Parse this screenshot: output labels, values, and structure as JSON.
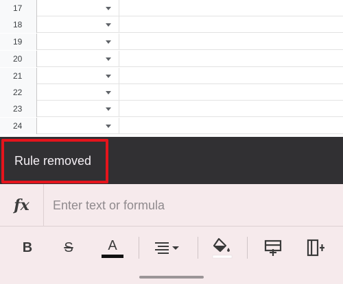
{
  "grid": {
    "rows": [
      {
        "num": "17"
      },
      {
        "num": "18"
      },
      {
        "num": "19"
      },
      {
        "num": "20"
      },
      {
        "num": "21"
      },
      {
        "num": "22"
      },
      {
        "num": "23"
      },
      {
        "num": "24"
      }
    ]
  },
  "snackbar": {
    "message": "Rule removed"
  },
  "formula_bar": {
    "fx_label": "fx",
    "placeholder": "Enter text or formula",
    "value": ""
  },
  "toolbar": {
    "bold_label": "B",
    "strikethrough_label": "S",
    "text_color_label": "A",
    "text_color": "#111111",
    "fill_color": "#ffffff"
  },
  "colors": {
    "snackbar_bg": "#313033",
    "highlight": "#e5141c",
    "toolbar_bg": "#f6eaec"
  }
}
